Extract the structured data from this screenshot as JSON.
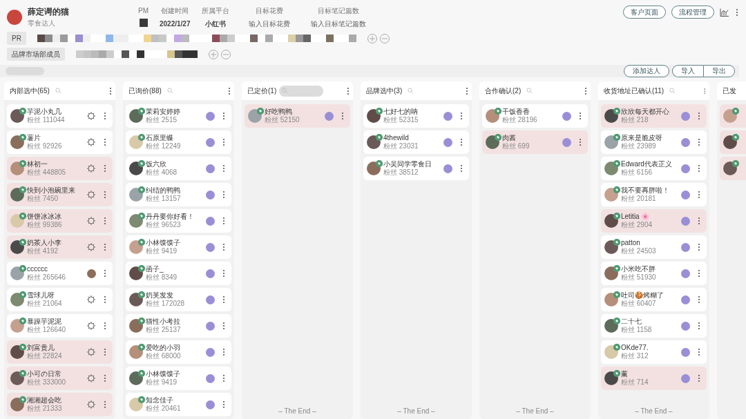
{
  "project": {
    "name": "薛定谔的猫",
    "subtitle": "零食达人"
  },
  "fields": [
    {
      "label": "PM",
      "kind": "avatar"
    },
    {
      "label": "创建时间",
      "kind": "text",
      "value": "2022/1/27"
    },
    {
      "label": "所属平台",
      "kind": "text",
      "value": "小红书"
    },
    {
      "label": "目标花费",
      "kind": "input",
      "placeholder": "输入目标花费"
    },
    {
      "label": "目标笔记篇数",
      "kind": "input",
      "placeholder": "输入目标笔记篇数"
    }
  ],
  "header_buttons": [
    "客户页面",
    "流程管理"
  ],
  "member_rows": [
    {
      "tag": "PR"
    },
    {
      "tag": "品牌市场部成员"
    }
  ],
  "toolbar_buttons": [
    "添加达人"
  ],
  "toolbar_group": [
    "导入",
    "导出"
  ],
  "columns": [
    {
      "title": "内部选中(65)",
      "search_focused": false,
      "cards": [
        {
          "name": "芋泥小丸几",
          "fans": "粉丝 111044",
          "highlighted": false,
          "kind": "gear"
        },
        {
          "name": "薯片",
          "fans": "粉丝 92926",
          "highlighted": false,
          "kind": "gear"
        },
        {
          "name": "林初一",
          "fans": "粉丝 448805",
          "highlighted": true,
          "kind": "gear"
        },
        {
          "name": "快到小泡碗里来",
          "fans": "粉丝 7450",
          "highlighted": true,
          "kind": "gear"
        },
        {
          "name": "饼饼冰冰冰",
          "fans": "粉丝 99386",
          "highlighted": true,
          "kind": "gear"
        },
        {
          "name": "奶茶人小李",
          "fans": "粉丝 4192",
          "highlighted": true,
          "kind": "gear"
        },
        {
          "name": "cccccc",
          "fans": "粉丝 265646",
          "highlighted": false,
          "kind": "photo"
        },
        {
          "name": "雪球儿呀",
          "fans": "粉丝 21064",
          "highlighted": false,
          "kind": "gear"
        },
        {
          "name": "暴躁芋泥泥",
          "fans": "粉丝 126640",
          "highlighted": false,
          "kind": "gear"
        },
        {
          "name": "刘富贵儿",
          "fans": "粉丝 22824",
          "highlighted": true,
          "kind": "gear"
        },
        {
          "name": "小可の日常",
          "fans": "粉丝 333000",
          "highlighted": true,
          "kind": "gear"
        },
        {
          "name": "湘湘超会吃",
          "fans": "粉丝 21333",
          "highlighted": true,
          "kind": "gear"
        }
      ]
    },
    {
      "title": "已询价(88)",
      "search_focused": false,
      "cards": [
        {
          "name": "茉莉安婷婷",
          "fans": "粉丝 2515",
          "highlighted": false,
          "kind": "status"
        },
        {
          "name": "石原里蝶",
          "fans": "粉丝 12249",
          "highlighted": false,
          "kind": "status"
        },
        {
          "name": "饭六欣",
          "fans": "粉丝 4068",
          "highlighted": false,
          "kind": "status"
        },
        {
          "name": "纠结的鸭鸭",
          "fans": "粉丝 13157",
          "highlighted": false,
          "kind": "status"
        },
        {
          "name": "丹丹要你好看！",
          "fans": "粉丝 96523",
          "highlighted": false,
          "kind": "status"
        },
        {
          "name": "小林馍馍子",
          "fans": "粉丝 9419",
          "highlighted": false,
          "kind": "status"
        },
        {
          "name": "函子_",
          "fans": "粉丝 8349",
          "highlighted": false,
          "kind": "status"
        },
        {
          "name": "奶芙发发",
          "fans": "粉丝 172028",
          "highlighted": false,
          "kind": "status"
        },
        {
          "name": "猫性小考拉",
          "fans": "粉丝 25137",
          "highlighted": false,
          "kind": "status"
        },
        {
          "name": "爱吃的小羽",
          "fans": "粉丝 68000",
          "highlighted": false,
          "kind": "status"
        },
        {
          "name": "小林馍馍子",
          "fans": "粉丝 9419",
          "highlighted": false,
          "kind": "status"
        },
        {
          "name": "知念佳子",
          "fans": "粉丝 20461",
          "highlighted": false,
          "kind": "status"
        }
      ]
    },
    {
      "title": "已定价(1)",
      "search_focused": true,
      "footer": "– The End –",
      "cards": [
        {
          "name": "好吃鸭鸭",
          "fans": "粉丝 52150",
          "highlighted": true,
          "kind": "status"
        }
      ]
    },
    {
      "title": "品牌选中(3)",
      "search_focused": false,
      "footer": "– The End –",
      "cards": [
        {
          "name": "七好七的呐",
          "fans": "粉丝 52315",
          "highlighted": false,
          "kind": "status"
        },
        {
          "name": "4thewild",
          "fans": "粉丝 23031",
          "highlighted": false,
          "kind": "status"
        },
        {
          "name": "小吴同学零食日",
          "fans": "粉丝 38512",
          "highlighted": false,
          "kind": "status"
        }
      ]
    },
    {
      "title": "合作确认(2)",
      "search_focused": false,
      "footer": "– The End –",
      "cards": [
        {
          "name": "干饭香香",
          "fans": "粉丝 28196",
          "highlighted": false,
          "kind": "status"
        },
        {
          "name": "肉酱",
          "fans": "粉丝 699",
          "highlighted": true,
          "kind": "status"
        }
      ]
    },
    {
      "title": "收货地址已确认(11)",
      "search_focused": false,
      "footer": "– The End –",
      "cards": [
        {
          "name": "欣欣每天都开心",
          "fans": "粉丝 218",
          "highlighted": true,
          "kind": "status"
        },
        {
          "name": "原来是脆皮呀",
          "fans": "粉丝 23989",
          "highlighted": false,
          "kind": "status"
        },
        {
          "name": "Edward代表正义",
          "fans": "粉丝 6156",
          "highlighted": false,
          "kind": "status"
        },
        {
          "name": "我不要再胖啦！",
          "fans": "粉丝 20181",
          "highlighted": false,
          "kind": "status"
        },
        {
          "name": "Letitia 🌸",
          "fans": "粉丝 2904",
          "highlighted": true,
          "kind": "status"
        },
        {
          "name": "patton",
          "fans": "粉丝 24503",
          "highlighted": false,
          "kind": "status"
        },
        {
          "name": "小米吃不胖",
          "fans": "粉丝 51930",
          "highlighted": false,
          "kind": "status"
        },
        {
          "name": "吐司🍪烤糊了",
          "fans": "粉丝 60407",
          "highlighted": false,
          "kind": "status"
        },
        {
          "name": "二十七",
          "fans": "粉丝 1158",
          "highlighted": false,
          "kind": "status"
        },
        {
          "name": "OKde77.",
          "fans": "粉丝 312",
          "highlighted": false,
          "kind": "status"
        },
        {
          "name": "薰",
          "fans": "粉丝 714",
          "highlighted": true,
          "kind": "status"
        }
      ]
    },
    {
      "title": "已发",
      "cards": [
        {
          "highlighted": true
        },
        {
          "highlighted": true
        },
        {
          "highlighted": true
        }
      ]
    }
  ]
}
